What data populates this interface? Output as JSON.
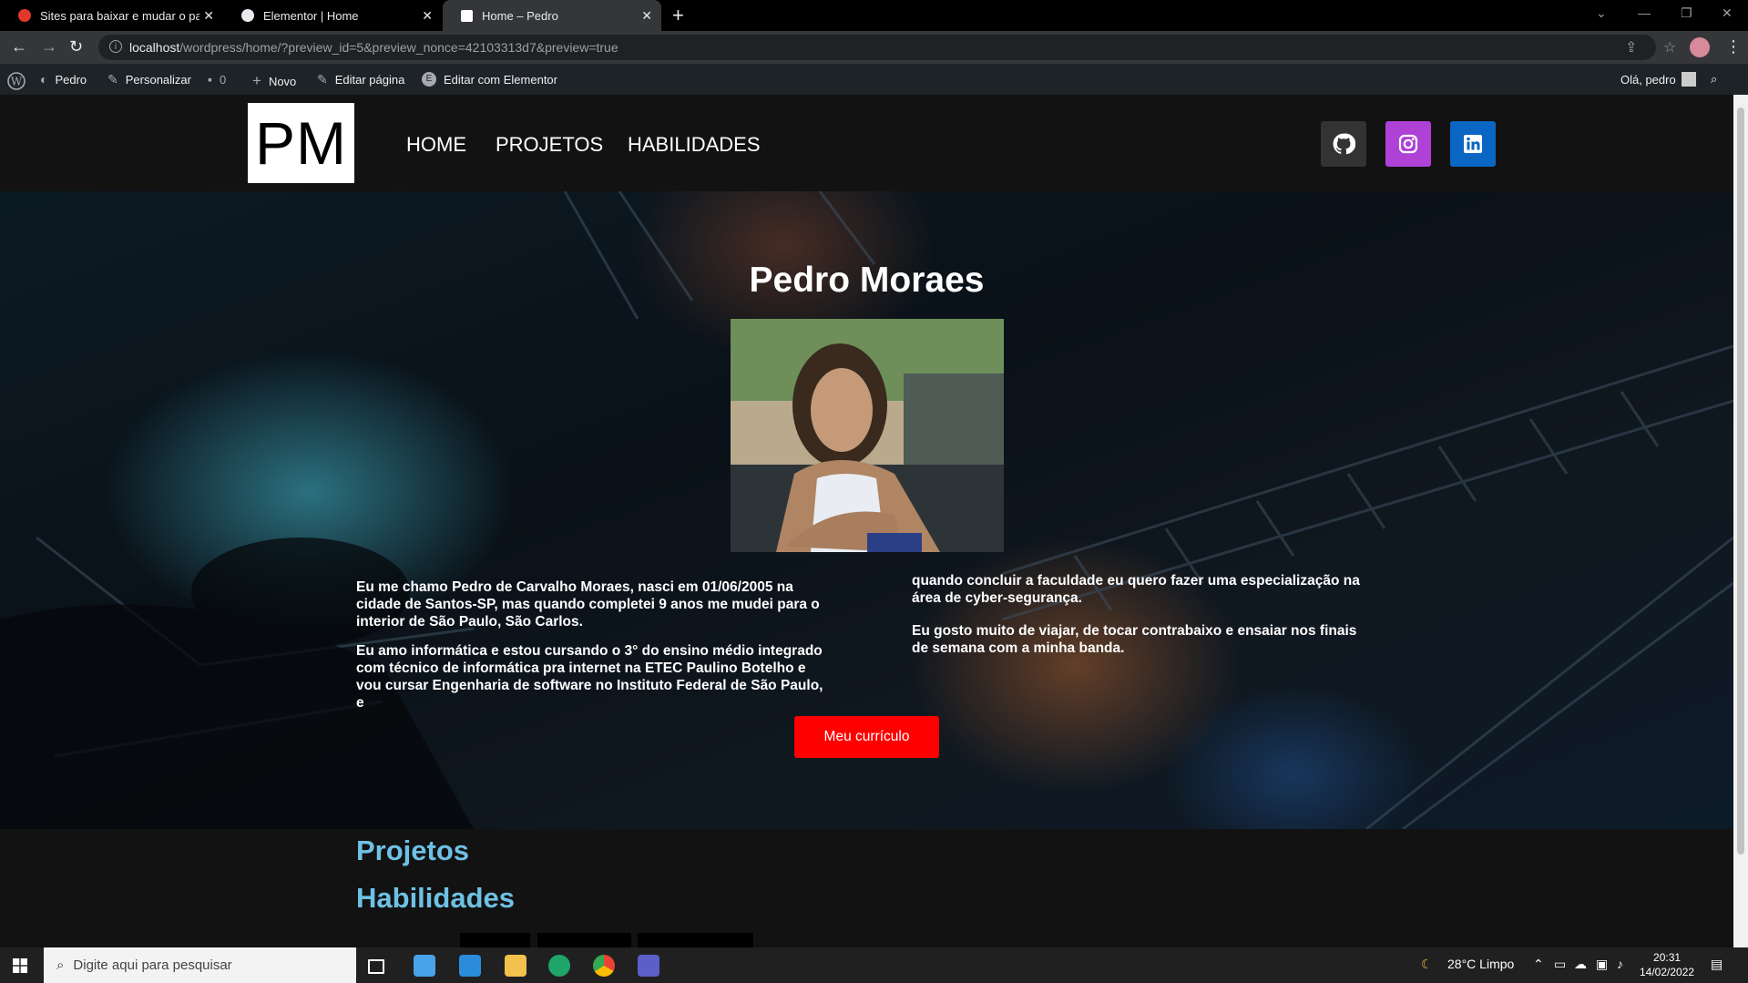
{
  "browser": {
    "tabs": [
      {
        "title": "Sites para baixar e mudar o pape",
        "active": false
      },
      {
        "title": "Elementor | Home",
        "active": false
      },
      {
        "title": "Home – Pedro",
        "active": true
      }
    ],
    "url_host": "localhost",
    "url_path": "/wordpress/home/?preview_id=5&preview_nonce=42103313d7&preview=true"
  },
  "wp_admin_bar": {
    "site_name": "Pedro",
    "customize": "Personalizar",
    "comments_count": "0",
    "new": "Novo",
    "edit_page": "Editar página",
    "edit_elementor": "Editar com Elementor",
    "greeting": "Olá, pedro"
  },
  "header": {
    "logo_text": "PM",
    "menu": [
      "HOME",
      "PROJETOS",
      "HABILIDADES"
    ],
    "social": [
      {
        "icon": "github-icon",
        "color": "#333333"
      },
      {
        "icon": "instagram-icon",
        "color": "#b041d6"
      },
      {
        "icon": "linkedin-icon",
        "color": "#0a66c2"
      }
    ]
  },
  "hero": {
    "title": "Pedro Moraes",
    "col1": [
      "Eu me chamo Pedro de Carvalho Moraes, nasci em 01/06/2005 na cidade de Santos-SP, mas quando completei 9 anos me mudei para o interior de São Paulo, São Carlos.",
      "Eu amo informática e estou cursando o 3° do ensino médio integrado com técnico de informática pra internet na ETEC Paulino Botelho e vou cursar Engenharia de software no Instituto Federal de São Paulo, e"
    ],
    "col2": [
      "quando concluir a faculdade eu quero fazer uma especialização na área de cyber-segurança.",
      "Eu gosto muito de viajar, de tocar contrabaixo e ensaiar nos finais de semana com a minha banda."
    ],
    "button": "Meu currículo",
    "button_color": "#ff0000"
  },
  "sections": {
    "projetos": "Projetos",
    "habilidades": "Habilidades",
    "heading_color": "#6ec1e4"
  },
  "taskbar": {
    "search_placeholder": "Digite aqui para pesquisar",
    "weather": "28°C  Limpo",
    "time": "20:31",
    "date": "14/02/2022"
  }
}
